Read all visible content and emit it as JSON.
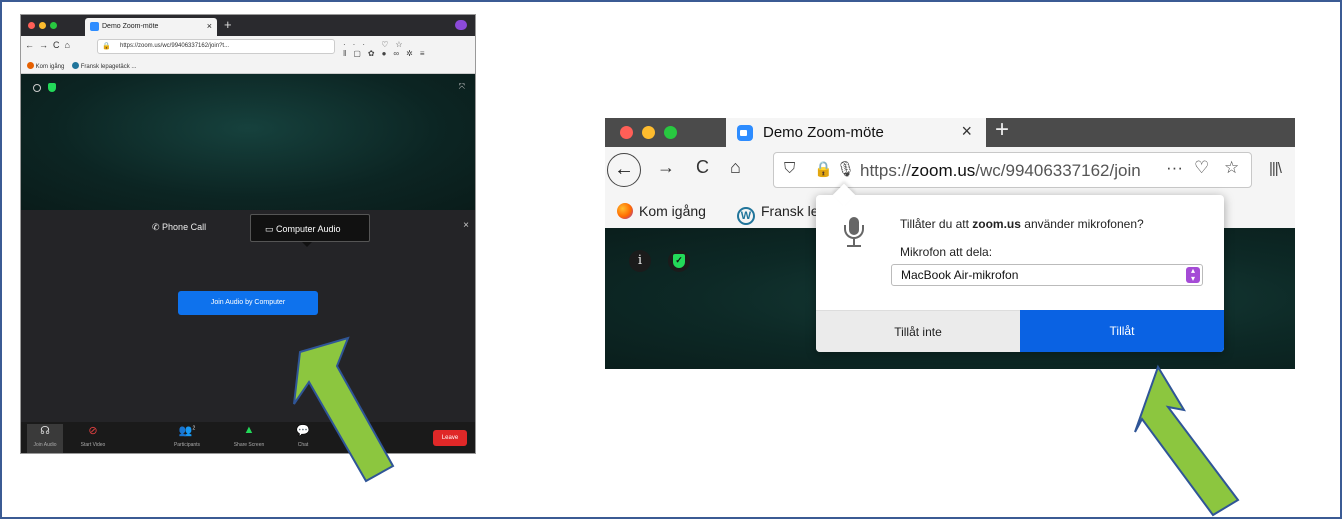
{
  "colors": {
    "frame_border": "#3b5b94",
    "zoom_blue": "#0e72ed",
    "firefox_allow_blue": "#0a62e3",
    "arrow_fill": "#8cc63f",
    "arrow_stroke": "#2f5597",
    "leave_red": "#e02828",
    "shield_green": "#23d959"
  },
  "left": {
    "tab": {
      "title": "Demo Zoom-möte",
      "close": "×"
    },
    "new_tab": "+",
    "nav": {
      "back": "←",
      "forward": "→",
      "reload": "C",
      "home": "⌂"
    },
    "url": "https://zoom.us/wc/99406337162/join?t...",
    "url_more": "···",
    "bookmarks": [
      "Kom igång",
      "Fransk lepagetäck ..."
    ],
    "audio_tabs": {
      "phone": "Phone Call",
      "computer": "Computer Audio"
    },
    "panel_close": "×",
    "join_button": "Join Audio by Computer",
    "toolbar": {
      "join_audio": "Join Audio",
      "start_video": "Start Video",
      "participants": "Participants",
      "participants_count": "2",
      "share_screen": "Share Screen",
      "chat": "Chat",
      "leave": "Leave"
    }
  },
  "right": {
    "tab": {
      "title": "Demo Zoom-möte",
      "close": "×"
    },
    "new_tab": "+",
    "nav": {
      "back": "←",
      "forward": "→",
      "reload": "C",
      "home": "⌂"
    },
    "url": {
      "prefix": "https://",
      "host": "zoom.us",
      "path": "/wc/99406337162/join",
      "more": "···"
    },
    "bookmarks": {
      "first": "Kom igång",
      "second": "Fransk lepag"
    },
    "video": {
      "info_glyph": "i"
    },
    "permission": {
      "question_before": "Tillåter du att ",
      "question_site": "zoom.us",
      "question_after": " använder mikrofonen?",
      "device_label": "Mikrofon att dela:",
      "device_selected": "MacBook Air-mikrofon",
      "deny_button": "Tillåt inte",
      "allow_button": "Tillåt"
    }
  }
}
